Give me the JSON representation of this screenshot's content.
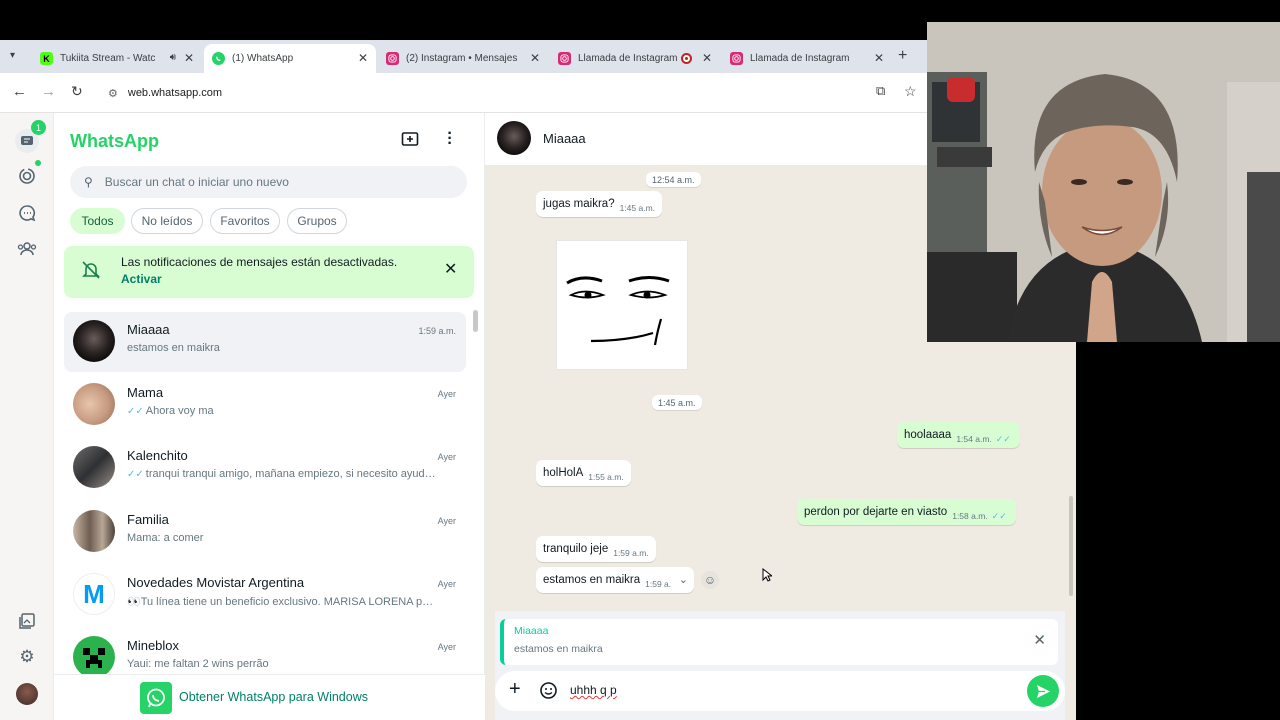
{
  "browser": {
    "tabs": [
      {
        "title": "Tukiita Stream - Watc",
        "favicon": "kick-icon",
        "color": "#53fc18",
        "active": false,
        "audio": true
      },
      {
        "title": "(1) WhatsApp",
        "favicon": "whatsapp-icon",
        "color": "#25d366",
        "active": true
      },
      {
        "title": "(2) Instagram • Mensajes",
        "favicon": "instagram-icon",
        "color": "#d62976",
        "active": false
      },
      {
        "title": "Llamada de Instagram",
        "favicon": "instagram-icon",
        "color": "#d62976",
        "active": false,
        "recording": true
      },
      {
        "title": "Llamada de Instagram",
        "favicon": "instagram-icon",
        "color": "#d62976",
        "active": false
      }
    ],
    "url": "web.whatsapp.com"
  },
  "rail": {
    "chats_badge": "1"
  },
  "sidebar": {
    "title": "WhatsApp",
    "search_placeholder": "Buscar un chat o iniciar uno nuevo",
    "filters": [
      "Todos",
      "No leídos",
      "Favoritos",
      "Grupos"
    ],
    "notice": {
      "text": "Las notificaciones de mensajes están desactivadas.",
      "action": "Activar"
    },
    "chats": [
      {
        "name": "Miaaaa",
        "time": "1:59 a.m.",
        "preview": "estamos en maikra",
        "ticks": false
      },
      {
        "name": "Mama",
        "time": "Ayer",
        "preview": "Ahora voy ma",
        "ticks": true
      },
      {
        "name": "Kalenchito",
        "time": "Ayer",
        "preview": "tranqui tranqui amigo, mañana empiezo, si necesito ayud…",
        "ticks": true
      },
      {
        "name": "Familia",
        "time": "Ayer",
        "preview": "Mama: a comer",
        "ticks": false
      },
      {
        "name": "Novedades Movistar Argentina",
        "time": "Ayer",
        "preview": "👀Tu línea tiene un beneficio exclusivo.  MARISA LORENA p…",
        "ticks": false
      },
      {
        "name": "Mineblox",
        "time": "Ayer",
        "preview": "Yaui: me faltan 2 wins perrão",
        "ticks": false
      }
    ],
    "get_app": "Obtener WhatsApp para Windows"
  },
  "conversation": {
    "contact": "Miaaaa",
    "date_chips": [
      "12:54 a.m.",
      "1:45 a.m."
    ],
    "messages": [
      {
        "dir": "in",
        "text": "jugas maikra?",
        "time": "1:45 a.m."
      },
      {
        "dir": "out",
        "text": "hoolaaaa",
        "time": "1:54 a.m."
      },
      {
        "dir": "in",
        "text": "holHolA",
        "time": "1:55 a.m."
      },
      {
        "dir": "out",
        "text": "perdon por dejarte en viasto",
        "time": "1:58 a.m."
      },
      {
        "dir": "in",
        "text": "tranquilo jeje",
        "time": "1:59 a.m."
      },
      {
        "dir": "in",
        "text": "estamos en maikra",
        "time": "1:59 a."
      }
    ],
    "reply": {
      "author": "Miaaaa",
      "text": "estamos en maikra"
    },
    "composer_value": "uhhh q p"
  }
}
